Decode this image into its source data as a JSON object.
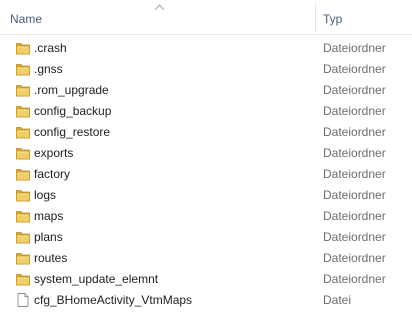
{
  "columns": {
    "name": "Name",
    "type": "Typ"
  },
  "rows": [
    {
      "name": ".crash",
      "type": "Dateiordner",
      "icon": "folder-icon"
    },
    {
      "name": ".gnss",
      "type": "Dateiordner",
      "icon": "folder-icon"
    },
    {
      "name": ".rom_upgrade",
      "type": "Dateiordner",
      "icon": "folder-icon"
    },
    {
      "name": "config_backup",
      "type": "Dateiordner",
      "icon": "folder-icon"
    },
    {
      "name": "config_restore",
      "type": "Dateiordner",
      "icon": "folder-icon"
    },
    {
      "name": "exports",
      "type": "Dateiordner",
      "icon": "folder-icon"
    },
    {
      "name": "factory",
      "type": "Dateiordner",
      "icon": "folder-icon"
    },
    {
      "name": "logs",
      "type": "Dateiordner",
      "icon": "folder-icon"
    },
    {
      "name": "maps",
      "type": "Dateiordner",
      "icon": "folder-icon"
    },
    {
      "name": "plans",
      "type": "Dateiordner",
      "icon": "folder-icon"
    },
    {
      "name": "routes",
      "type": "Dateiordner",
      "icon": "folder-icon"
    },
    {
      "name": "system_update_elemnt",
      "type": "Dateiordner",
      "icon": "folder-icon"
    },
    {
      "name": "cfg_BHomeActivity_VtmMaps",
      "type": "Datei",
      "icon": "file-icon"
    }
  ],
  "sort": {
    "column": "name",
    "direction": "ascending"
  },
  "colors": {
    "header_text": "#4c607a",
    "folder": "#e8c15a",
    "type_text": "#6d6d6d"
  }
}
